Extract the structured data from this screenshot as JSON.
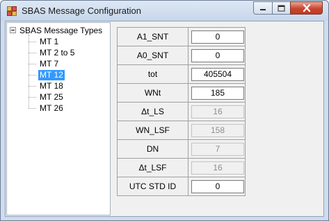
{
  "window": {
    "title": "SBAS Message Configuration"
  },
  "tree": {
    "root_label": "SBAS Message Types",
    "items": [
      {
        "label": "MT 1",
        "selected": false
      },
      {
        "label": "MT 2 to 5",
        "selected": false
      },
      {
        "label": "MT 7",
        "selected": false
      },
      {
        "label": "MT 12",
        "selected": true
      },
      {
        "label": "MT 18",
        "selected": false
      },
      {
        "label": "MT 25",
        "selected": false
      },
      {
        "label": "MT 26",
        "selected": false
      }
    ]
  },
  "params": [
    {
      "label": "A1_SNT",
      "value": "0",
      "enabled": true
    },
    {
      "label": "A0_SNT",
      "value": "0",
      "enabled": true
    },
    {
      "label": "tot",
      "value": "405504",
      "enabled": true
    },
    {
      "label": "WNt",
      "value": "185",
      "enabled": true
    },
    {
      "label": "Δt_LS",
      "value": "16",
      "enabled": false
    },
    {
      "label": "WN_LSF",
      "value": "158",
      "enabled": false
    },
    {
      "label": "DN",
      "value": "7",
      "enabled": false
    },
    {
      "label": "Δt_LSF",
      "value": "16",
      "enabled": false
    },
    {
      "label": "UTC STD ID",
      "value": "0",
      "enabled": true
    }
  ]
}
